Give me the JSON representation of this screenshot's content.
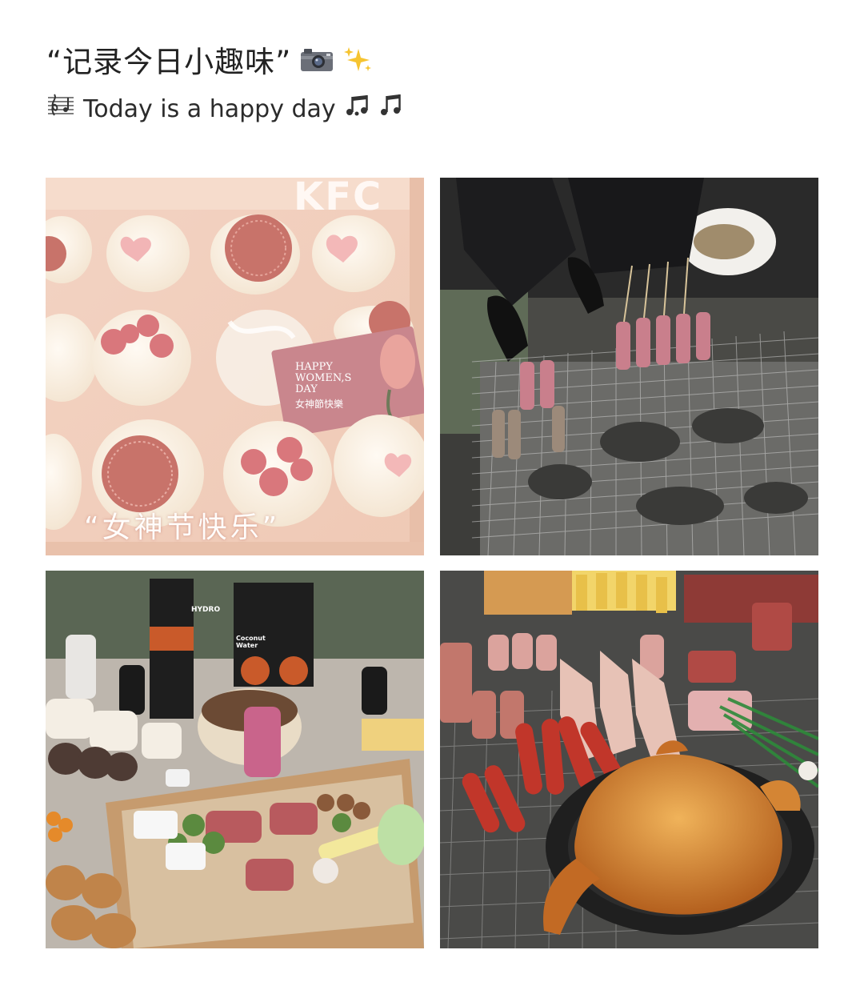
{
  "post": {
    "title": "“记录今日小趣味”",
    "subtitle": "Today is a happy day",
    "title_icons": [
      "camera-icon",
      "sparkles-icon"
    ],
    "subtitle_icons": [
      "music-score-icon",
      "music-notes-icon",
      "music-note-icon"
    ]
  },
  "photos": {
    "cupcakes": {
      "box_text": "KFC",
      "card_line1": "HAPPY",
      "card_line2": "WOMEN,S",
      "card_line3": "DAY",
      "card_cn": "女神節快樂",
      "caption": "“女神节快乐”"
    },
    "picnic": {
      "juice_brand": "HYDRO",
      "juice_sub": "Coconut Water"
    }
  }
}
